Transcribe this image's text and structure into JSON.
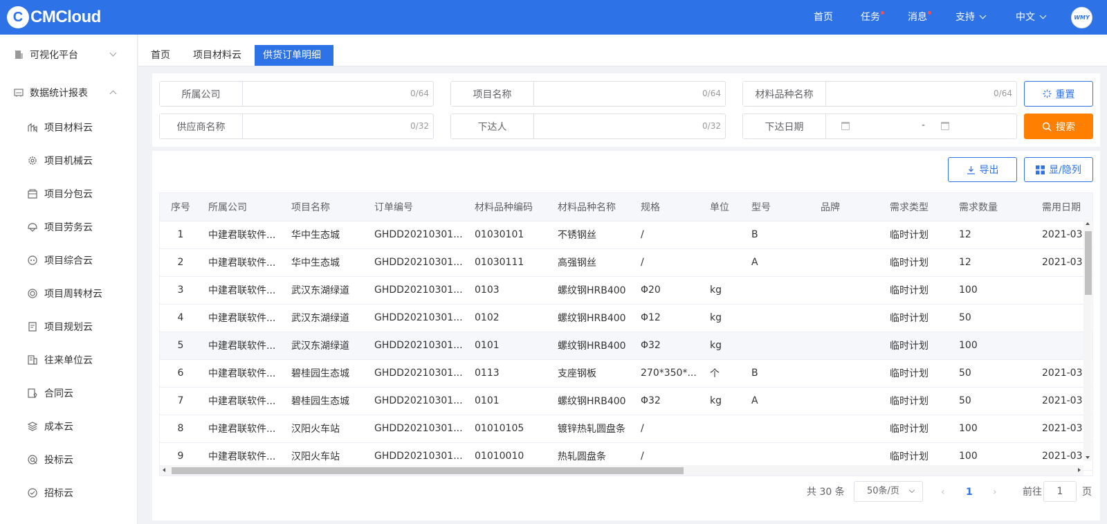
{
  "header": {
    "logo_mark": "C",
    "logo_text": "CMCloud",
    "nav": {
      "home": "首页",
      "tasks": "任务",
      "messages": "消息",
      "support": "支持",
      "language": "中文"
    },
    "avatar_text": "WMY"
  },
  "sidebar": {
    "groups": [
      {
        "label": "可视化平台",
        "icon": "building-icon"
      },
      {
        "label": "数据统计报表",
        "icon": "report-icon"
      }
    ],
    "items": [
      {
        "label": "项目材料云",
        "icon": "materials-icon"
      },
      {
        "label": "项目机械云",
        "icon": "gear-icon"
      },
      {
        "label": "项目分包云",
        "icon": "package-icon"
      },
      {
        "label": "项目劳务云",
        "icon": "helmet-icon"
      },
      {
        "label": "项目综合云",
        "icon": "cloud-icon"
      },
      {
        "label": "项目周转材云",
        "icon": "cycle-icon"
      },
      {
        "label": "项目规划云",
        "icon": "plan-icon"
      },
      {
        "label": "往来单位云",
        "icon": "office-building-icon"
      },
      {
        "label": "合同云",
        "icon": "contract-icon"
      },
      {
        "label": "成本云",
        "icon": "layers-icon"
      },
      {
        "label": "投标云",
        "icon": "bid-icon"
      },
      {
        "label": "招标云",
        "icon": "tender-icon"
      }
    ]
  },
  "tabs": [
    "首页",
    "项目材料云",
    "供货订单明细"
  ],
  "filters": {
    "company": {
      "label": "所属公司",
      "count": "0/64"
    },
    "project": {
      "label": "项目名称",
      "count": "0/64"
    },
    "material": {
      "label": "材料品种名称",
      "count": "0/64"
    },
    "supplier": {
      "label": "供应商名称",
      "count": "0/32"
    },
    "issuer": {
      "label": "下达人",
      "count": "0/32"
    },
    "date": {
      "label": "下达日期",
      "separator": "-"
    }
  },
  "buttons": {
    "reset": "重置",
    "search": "搜索",
    "export": "导出",
    "columns": "显/隐列"
  },
  "table": {
    "headers": [
      "序号",
      "所属公司",
      "项目名称",
      "订单编号",
      "材料品种编码",
      "材料品种名称",
      "规格",
      "单位",
      "型号",
      "品牌",
      "需求类型",
      "需求数量",
      "需用日期"
    ],
    "rows": [
      [
        "1",
        "中建君联软件...",
        "华中生态城",
        "GHDD20210301...",
        "01030101",
        "不锈钢丝",
        "/",
        "",
        "B",
        "",
        "临时计划",
        "12",
        "2021-03"
      ],
      [
        "2",
        "中建君联软件...",
        "华中生态城",
        "GHDD20210301...",
        "01030111",
        "高强钢丝",
        "/",
        "",
        "A",
        "",
        "临时计划",
        "12",
        "2021-03"
      ],
      [
        "3",
        "中建君联软件...",
        "武汉东湖绿道",
        "GHDD20210301...",
        "0103",
        "螺纹钢HRB400",
        "Φ20",
        "kg",
        "",
        "",
        "临时计划",
        "100",
        ""
      ],
      [
        "4",
        "中建君联软件...",
        "武汉东湖绿道",
        "GHDD20210301...",
        "0102",
        "螺纹钢HRB400",
        "Φ12",
        "kg",
        "",
        "",
        "临时计划",
        "50",
        ""
      ],
      [
        "5",
        "中建君联软件...",
        "武汉东湖绿道",
        "GHDD20210301...",
        "0101",
        "螺纹钢HRB400",
        "Φ32",
        "kg",
        "",
        "",
        "临时计划",
        "100",
        ""
      ],
      [
        "6",
        "中建君联软件...",
        "碧桂园生态城",
        "GHDD20210301...",
        "0113",
        "支座钢板",
        "270*350*...",
        "个",
        "B",
        "",
        "临时计划",
        "50",
        "2021-03"
      ],
      [
        "7",
        "中建君联软件...",
        "碧桂园生态城",
        "GHDD20210301...",
        "0101",
        "螺纹钢HRB400",
        "Φ32",
        "kg",
        "A",
        "",
        "临时计划",
        "50",
        "2021-03"
      ],
      [
        "8",
        "中建君联软件...",
        "汉阳火车站",
        "GHDD20210301...",
        "01010105",
        "镀锌热轧圆盘条",
        "/",
        "",
        "",
        "",
        "临时计划",
        "100",
        "2021-03"
      ],
      [
        "9",
        "中建君联软件...",
        "汉阳火车站",
        "GHDD20210301...",
        "01010010",
        "热轧圆盘条",
        "/",
        "",
        "",
        "",
        "临时计划",
        "100",
        "2021-03"
      ]
    ],
    "highlighted_row": 5
  },
  "pagination": {
    "total": "共 30 条",
    "page_size": "50条/页",
    "current_page": "1",
    "goto_prefix": "前往",
    "goto_value": "1",
    "goto_suffix": "页"
  },
  "colors": {
    "primary": "#2d72e6",
    "orange": "#ff7f00",
    "badge": "#ff4d4f"
  }
}
